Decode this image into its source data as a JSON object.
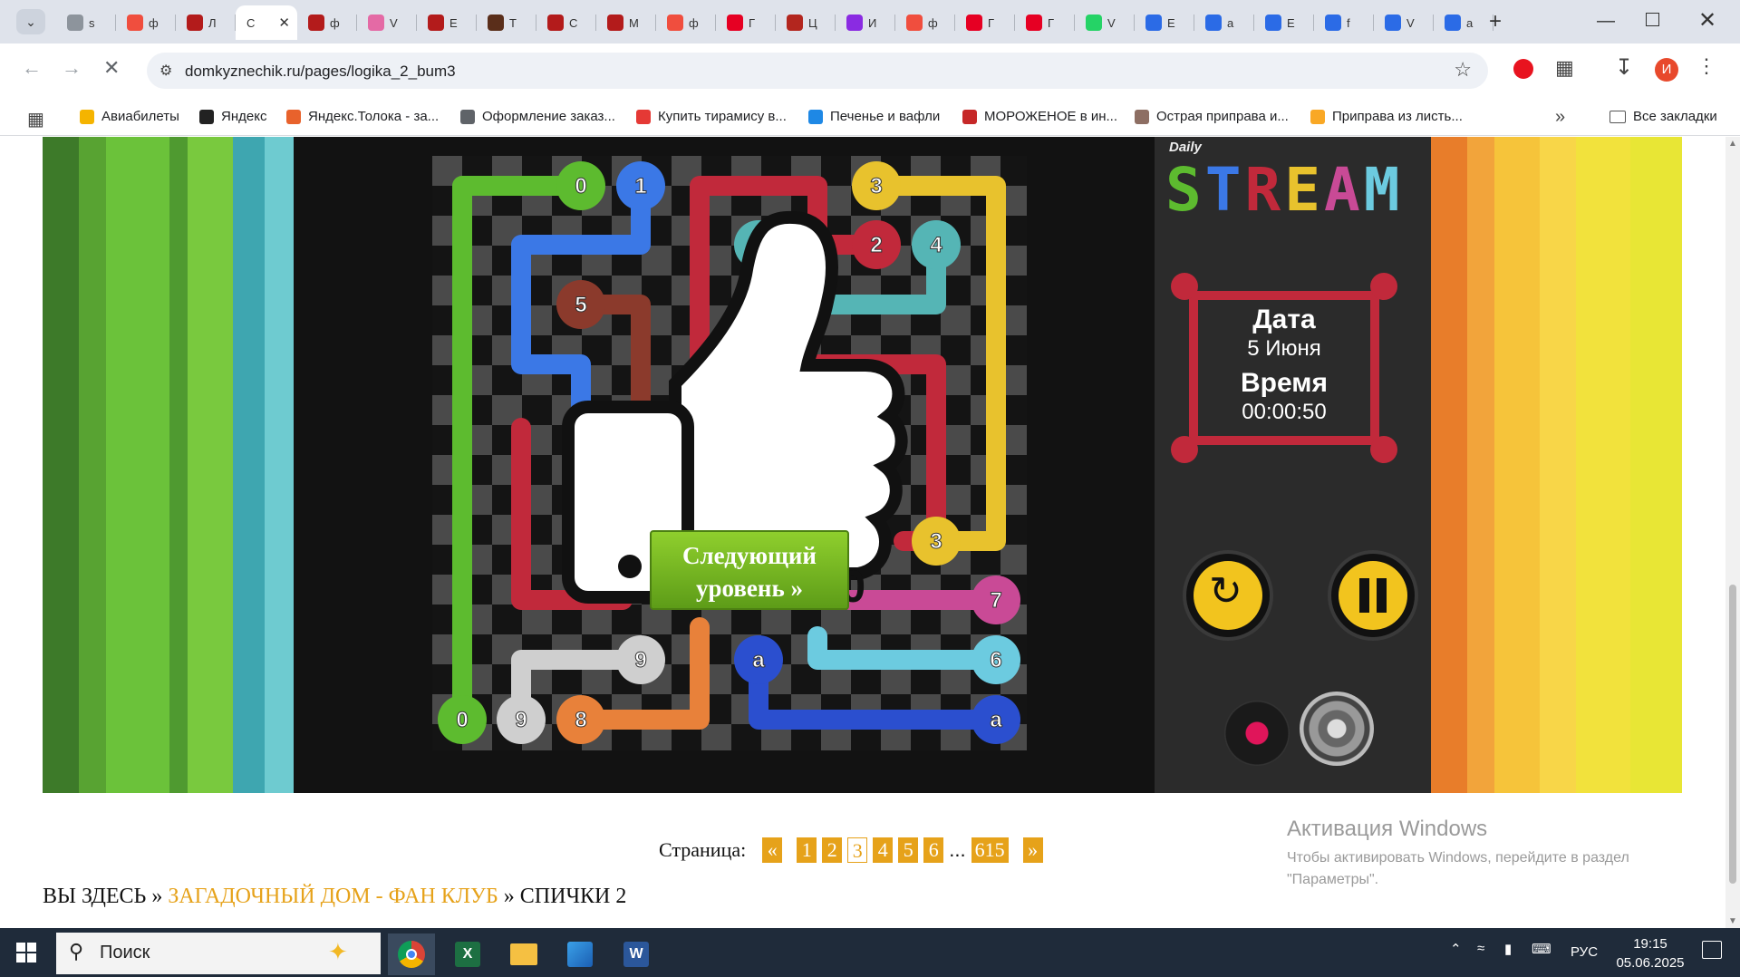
{
  "browser": {
    "tabs": [
      {
        "letter": "s",
        "color": "#8d949c"
      },
      {
        "letter": "ф",
        "color": "#f04e3e"
      },
      {
        "letter": "Л",
        "color": "#b31b1b"
      },
      {
        "letter": "С",
        "color": "#ffffff",
        "active": true
      },
      {
        "letter": "ф",
        "color": "#b31b1b"
      },
      {
        "letter": "V",
        "color": "#e46aa5"
      },
      {
        "letter": "E",
        "color": "#b31b1b"
      },
      {
        "letter": "Т",
        "color": "#5a2e1a"
      },
      {
        "letter": "С",
        "color": "#b31b1b"
      },
      {
        "letter": "M",
        "color": "#b31b1b"
      },
      {
        "letter": "ф",
        "color": "#f04e3e"
      },
      {
        "letter": "Г",
        "color": "#e60023"
      },
      {
        "letter": "Ц",
        "color": "#b3261e"
      },
      {
        "letter": "И",
        "color": "#8a2be2"
      },
      {
        "letter": "ф",
        "color": "#f04e3e"
      },
      {
        "letter": "Г",
        "color": "#e60023"
      },
      {
        "letter": "Г",
        "color": "#e60023"
      },
      {
        "letter": "V",
        "color": "#25d366"
      },
      {
        "letter": "E",
        "color": "#2b6be6"
      },
      {
        "letter": "а",
        "color": "#2b6be6"
      },
      {
        "letter": "E",
        "color": "#2b6be6"
      },
      {
        "letter": "f",
        "color": "#2b6be6"
      },
      {
        "letter": "V",
        "color": "#2b6be6"
      },
      {
        "letter": "а",
        "color": "#2b6be6"
      }
    ],
    "url": "domkyznechik.ru/pages/logika_2_bum3",
    "bookmarks": [
      {
        "label": "Авиабилеты",
        "color": "#f5b400"
      },
      {
        "label": "Яндекс",
        "color": "#222222"
      },
      {
        "label": "Яндекс.Толока - за...",
        "color": "#e8622c"
      },
      {
        "label": "Оформление заказ...",
        "color": "#5f6368"
      },
      {
        "label": "Купить тирамису в...",
        "color": "#e53935"
      },
      {
        "label": "Печенье и вафли",
        "color": "#1e88e5"
      },
      {
        "label": "МОРОЖЕНОЕ в ин...",
        "color": "#c62828"
      },
      {
        "label": "Острая приправа и...",
        "color": "#8d6e63"
      },
      {
        "label": "Приправа из листь...",
        "color": "#f9a825"
      }
    ],
    "all_bookmarks": "Все закладки",
    "avatar_letter": "И"
  },
  "game": {
    "logo_daily": "Daily",
    "logo_stream": "STREAM",
    "info": {
      "date_title": "Дата",
      "date_value": "5 Июня",
      "time_title": "Время",
      "time_value": "00:00:50"
    },
    "popup": {
      "timer": "00:00:50",
      "next_button": "Следующий уровень »"
    },
    "node_labels": [
      "0",
      "1",
      "3",
      "4",
      "2",
      "4",
      "5",
      "3",
      "7",
      "6",
      "9",
      "a",
      "0",
      "9",
      "8",
      "a"
    ]
  },
  "pager": {
    "label": "Страница:",
    "prev": "«",
    "pages": [
      "1",
      "2",
      "3",
      "4",
      "5",
      "6"
    ],
    "current": "3",
    "dots": "...",
    "last": "615",
    "next": "»"
  },
  "breadcrumb": {
    "prefix": "ВЫ ЗДЕСЬ",
    "sep": "»",
    "link": "ЗАГАДОЧНЫЙ ДОМ - ФАН КЛУБ",
    "current": "СПИЧКИ 2"
  },
  "activation": {
    "title": "Активация Windows",
    "text": "Чтобы активировать Windows, перейдите в раздел \"Параметры\"."
  },
  "taskbar": {
    "search_placeholder": "Поиск",
    "lang": "РУС",
    "time": "19:15",
    "date": "05.06.2025"
  }
}
